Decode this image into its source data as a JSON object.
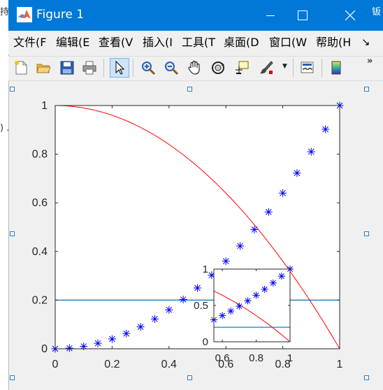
{
  "background_text": {
    "left_top": "持",
    "left_mid": ") .",
    "right_top": "钣"
  },
  "window": {
    "title": "Figure 1",
    "menu": [
      "文件(F",
      "编辑(E",
      "查看(V",
      "插入(I",
      "工具(T",
      "桌面(D",
      "窗口(W",
      "帮助(H"
    ],
    "menu_overflow": "↘",
    "toolbar_overflow": "»",
    "toolbar_icons": [
      "new-figure-icon",
      "open-file-icon",
      "save-icon",
      "print-icon",
      "pointer-icon",
      "zoom-in-icon",
      "zoom-out-icon",
      "pan-hand-icon",
      "rotate-3d-icon",
      "data-cursor-icon",
      "brush-icon",
      "brush-dropdown-icon",
      "link-plot-icon",
      "colorbar-icon"
    ]
  },
  "chart_data": [
    {
      "type": "line",
      "role": "main-axes",
      "xlim": [
        0,
        1
      ],
      "ylim": [
        0,
        1
      ],
      "xticks": [
        "0",
        "0.2",
        "0.4",
        "0.6",
        "0.8",
        "1"
      ],
      "yticks": [
        "0",
        "0.2",
        "0.4",
        "0.6",
        "0.8",
        "1"
      ],
      "series": [
        {
          "style": "blue-asterisk-markers",
          "color": "#0000ff",
          "x": [
            0,
            0.05,
            0.1,
            0.15,
            0.2,
            0.25,
            0.3,
            0.35,
            0.4,
            0.45,
            0.5,
            0.55,
            0.6,
            0.65,
            0.7,
            0.75,
            0.8,
            0.85,
            0.9,
            0.95,
            1.0
          ],
          "y": [
            0,
            0.0025,
            0.01,
            0.0225,
            0.04,
            0.0625,
            0.09,
            0.1225,
            0.16,
            0.2025,
            0.25,
            0.3025,
            0.36,
            0.4225,
            0.49,
            0.5625,
            0.64,
            0.7225,
            0.81,
            0.9025,
            1.0
          ]
        },
        {
          "style": "red-line",
          "color": "#ff0000",
          "equation": "y = 1 - x^2"
        },
        {
          "style": "horizontal-line",
          "color": "#0072bd",
          "y": 0.2
        }
      ]
    },
    {
      "type": "line",
      "role": "inset-axes",
      "xlim": [
        0.55,
        1
      ],
      "ylim": [
        0,
        1
      ],
      "xticks": [
        "0.6",
        "0.8",
        "1"
      ],
      "yticks": [
        "0",
        "0.5",
        "1"
      ],
      "series": [
        {
          "style": "blue-asterisk-markers",
          "color": "#0000ff",
          "x": [
            0.55,
            0.6,
            0.65,
            0.7,
            0.75,
            0.8,
            0.85,
            0.9,
            0.95,
            1.0
          ],
          "y": [
            0.3025,
            0.36,
            0.4225,
            0.49,
            0.5625,
            0.64,
            0.7225,
            0.81,
            0.9025,
            1.0
          ]
        },
        {
          "style": "red-line",
          "color": "#ff0000",
          "equation": "y = 1 - x^2"
        },
        {
          "style": "horizontal-line",
          "color": "#0072bd",
          "y": 0.2
        }
      ]
    }
  ]
}
